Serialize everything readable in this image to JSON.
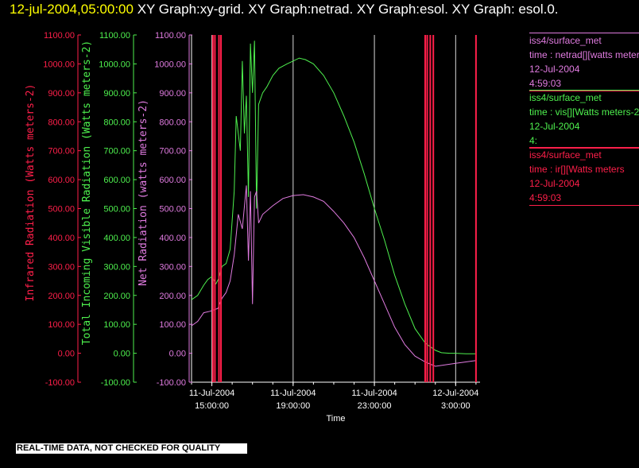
{
  "header": {
    "timestamp": "12-jul-2004,05:00:00",
    "title_rest": "XY Graph:xy-grid.  XY Graph:netrad.  XY Graph:esol.  XY Graph: esol.0."
  },
  "legends": [
    {
      "source": "iss4/surface_met",
      "var": "time : netrad[][watts meters",
      "date": "12-Jul-2004",
      "time": "4:59:03"
    },
    {
      "source": "iss4/surface_met",
      "var": "time : vis[][Watts meters-2",
      "date": "12-Jul-2004",
      "time": "4:"
    },
    {
      "source": "iss4/surface_met",
      "var": "time : ir[][Watts meters",
      "date": "12-Jul-2004",
      "time": "4:59:03"
    }
  ],
  "disclaimer": "REAL-TIME DATA, NOT CHECKED FOR QUALITY",
  "colors": {
    "ir": "#ff1f4a",
    "vis": "#4ef04e",
    "net": "#e07be0",
    "grid": "#ffffff",
    "background": "#000000"
  },
  "chart_data": {
    "type": "line",
    "xlabel": "Time",
    "x_ticks": [
      {
        "t": 15,
        "date": "11-Jul-2004",
        "time": "15:00:00"
      },
      {
        "t": 19,
        "date": "11-Jul-2004",
        "time": "19:00:00"
      },
      {
        "t": 23,
        "date": "11-Jul-2004",
        "time": "23:00:00"
      },
      {
        "t": 27,
        "date": "12-Jul-2004",
        "time": "3:00:00"
      }
    ],
    "x_unit": "hours from 11-Jul-2004 00:00",
    "xlim": [
      14.0,
      28.2
    ],
    "ylim": [
      -100,
      1100
    ],
    "y_ticks": [
      -100,
      0,
      100,
      200,
      300,
      400,
      500,
      600,
      700,
      800,
      900,
      1000,
      1100
    ],
    "y_tick_labels": [
      "-100.00",
      "0.00",
      "100.00",
      "200.00",
      "300.00",
      "400.00",
      "500.00",
      "600.00",
      "700.00",
      "800.00",
      "900.00",
      "1000.00",
      "1100.00"
    ],
    "axes": [
      {
        "name": "ir",
        "label": "Infrared Radiation (Watts meters-2)",
        "color": "#ff1f4a"
      },
      {
        "name": "vis",
        "label": "Total Incoming Visible Radiation (Watts meters-2)",
        "color": "#4ef04e"
      },
      {
        "name": "net",
        "label": "Net Radiation (watts meters-2)",
        "color": "#e07be0"
      }
    ],
    "series": [
      {
        "name": "time : vis[][Watts meters-2",
        "axis": "vis",
        "color": "#4ef04e",
        "x": [
          14.0,
          14.3,
          14.6,
          14.8,
          15.0,
          15.2,
          15.35,
          15.5,
          15.7,
          15.9,
          16.1,
          16.2,
          16.4,
          16.5,
          16.6,
          16.7,
          16.8,
          16.9,
          17.0,
          17.1,
          17.2,
          17.3,
          17.5,
          17.7,
          18.0,
          18.3,
          18.7,
          19.0,
          19.3,
          19.6,
          20.0,
          20.5,
          21.0,
          21.5,
          22.0,
          22.5,
          23.0,
          23.5,
          24.0,
          24.5,
          25.0,
          25.5,
          26.0,
          26.3,
          26.7,
          27.0,
          27.5,
          28.0
        ],
        "y": [
          185,
          200,
          235,
          255,
          265,
          240,
          260,
          300,
          310,
          360,
          560,
          820,
          700,
          1010,
          760,
          890,
          540,
          1070,
          900,
          1080,
          500,
          860,
          900,
          920,
          960,
          985,
          1000,
          1010,
          1020,
          1015,
          1000,
          960,
          900,
          820,
          730,
          620,
          500,
          390,
          270,
          170,
          85,
          35,
          10,
          2,
          0,
          0,
          -2,
          -2
        ]
      },
      {
        "name": "time : netrad[][watts meters",
        "axis": "net",
        "color": "#e07be0",
        "x": [
          14.0,
          14.3,
          14.6,
          14.9,
          15.1,
          15.3,
          15.5,
          15.7,
          15.9,
          16.1,
          16.3,
          16.5,
          16.7,
          16.8,
          16.9,
          17.0,
          17.1,
          17.2,
          17.3,
          17.5,
          18.0,
          18.5,
          19.0,
          19.5,
          20.0,
          20.5,
          21.0,
          21.5,
          22.0,
          22.5,
          23.0,
          23.5,
          24.0,
          24.5,
          25.0,
          25.5,
          26.0,
          26.5,
          27.0,
          27.5,
          28.0
        ],
        "y": [
          95,
          110,
          140,
          145,
          150,
          155,
          190,
          210,
          250,
          340,
          480,
          430,
          580,
          320,
          560,
          170,
          540,
          560,
          450,
          480,
          510,
          535,
          545,
          548,
          540,
          525,
          490,
          450,
          400,
          330,
          250,
          170,
          90,
          30,
          -10,
          -30,
          -45,
          -40,
          -35,
          -30,
          -25
        ]
      }
    ],
    "ir_spikes": [
      15.05,
      15.15,
      15.35,
      15.45,
      25.5,
      25.6,
      25.75,
      25.9,
      28.0
    ]
  }
}
